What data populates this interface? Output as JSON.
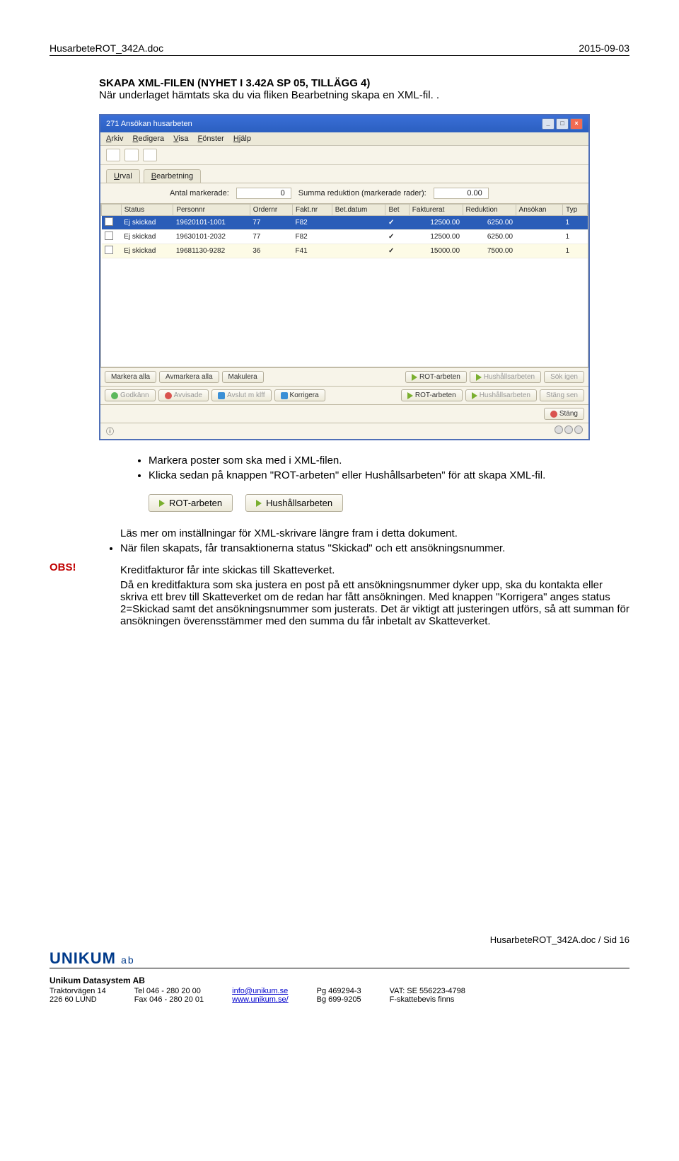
{
  "header": {
    "docname": "HusarbeteROT_342A.doc",
    "date": "2015-09-03"
  },
  "section": {
    "title": "SKAPA XML-FILEN (NYHET I 3.42A SP 05, TILLÄGG 4)",
    "sub": "När underlaget hämtats ska du via fliken Bearbetning skapa en XML-fil. ."
  },
  "win": {
    "title": "271 Ansökan husarbeten",
    "menu": [
      "Arkiv",
      "Redigera",
      "Visa",
      "Fönster",
      "Hjälp"
    ],
    "tabs": [
      "Urval",
      "Bearbetning"
    ],
    "countsLabel1": "Antal markerade:",
    "counts1": "0",
    "countsLabel2": "Summa reduktion (markerade rader):",
    "counts2": "0.00",
    "cols": [
      "",
      "Status",
      "Personnr",
      "Ordernr",
      "Fakt.nr",
      "Bet.datum",
      "Bet",
      "Fakturerat",
      "Reduktion",
      "Ansökan",
      "Typ"
    ],
    "rows": [
      {
        "sel": "",
        "status": "Ej skickad",
        "pnr": "19620101-1001",
        "ord": "77",
        "fkt": "F82",
        "dat": "",
        "bet": "✓",
        "fak": "12500.00",
        "red": "6250.00",
        "ans": "",
        "typ": "1"
      },
      {
        "sel": "",
        "status": "Ej skickad",
        "pnr": "19630101-2032",
        "ord": "77",
        "fkt": "F82",
        "dat": "",
        "bet": "✓",
        "fak": "12500.00",
        "red": "6250.00",
        "ans": "",
        "typ": "1"
      },
      {
        "sel": "",
        "status": "Ej skickad",
        "pnr": "19681130-9282",
        "ord": "36",
        "fkt": "F41",
        "dat": "",
        "bet": "✓",
        "fak": "15000.00",
        "red": "7500.00",
        "ans": "",
        "typ": "1"
      }
    ],
    "btns": {
      "markall": "Markera alla",
      "unmarkall": "Avmarkera alla",
      "makulera": "Makulera",
      "rot": "ROT-arbeten",
      "hush": "Hushållsarbeten",
      "sokign": "Sök igen",
      "godk": "Godkänn",
      "avvis": "Avvisade",
      "avsl": "Avslut m klff",
      "korr": "Korrigera",
      "rot2": "ROT-arbeten",
      "hund": "Hushållsarbeten",
      "stapa": "Stäng sen",
      "stang": "Stäng"
    }
  },
  "bullets1": [
    "Markera poster som ska med i XML-filen.",
    "Klicka sedan på knappen \"ROT-arbeten\" eller Hushållsarbeten\" för att skapa XML-fil."
  ],
  "smallbtn": {
    "rot": "ROT-arbeten",
    "hus": "Hushållsarbeten"
  },
  "obs": "OBS!",
  "preline": "Läs mer om inställningar för XML-skrivare längre fram i detta dokument.",
  "bullets2": [
    "När filen skapats, får transaktionerna status \"Skickad\" och ett ansökningsnummer."
  ],
  "para1": "Kreditfakturor får inte skickas till Skatteverket.",
  "para2": "Då en kreditfaktura som ska justera en post på ett ansökningsnummer dyker upp, ska du kontakta eller skriva ett brev till Skatteverket om de redan har fått ansökningen. Med knappen \"Korrigera\" anges status 2=Skickad samt det ansökningsnummer som justerats. Det är viktigt att justeringen utförs, så att summan för ansökningen överensstämmer med den summa du får inbetalt av Skatteverket.",
  "footer": {
    "page": "HusarbeteROT_342A.doc / Sid 16",
    "company": "UNIKUM",
    "ab": "ab",
    "sub": "Unikum Datasystem AB",
    "col1": [
      "Traktorvägen 14",
      "226 60  LUND"
    ],
    "col2": [
      "Tel  046 - 280 20 00",
      "Fax  046 - 280 20 01"
    ],
    "col3": [
      "info@unikum.se",
      "www.unikum.se/"
    ],
    "col4": [
      "Pg  469294-3",
      "Bg  699-9205"
    ],
    "col5": [
      "VAT: SE 556223-4798",
      "F-skattebevis finns"
    ]
  }
}
